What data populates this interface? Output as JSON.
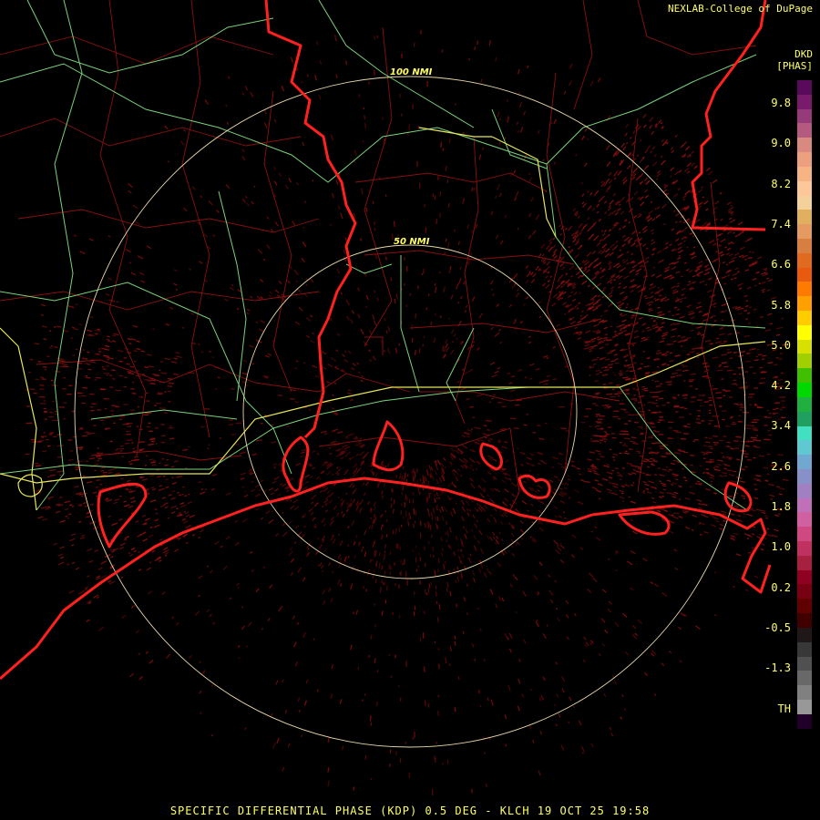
{
  "credit": "NEXLAB-College of DuPage",
  "legend": {
    "product": "DKD",
    "unit": "[PHAS]",
    "ticks": [
      "9.8",
      "9.0",
      "8.2",
      "7.4",
      "6.6",
      "5.8",
      "5.0",
      "4.2",
      "3.4",
      "2.6",
      "1.8",
      "1.0",
      "0.2",
      "-0.5",
      "-1.3",
      "TH"
    ],
    "colors": [
      "#5a0a5a",
      "#7a1a6a",
      "#963a7a",
      "#b45a80",
      "#d88a80",
      "#eca080",
      "#f6b484",
      "#fcc89a",
      "#f4d09a",
      "#e0b060",
      "#e49a60",
      "#d87e40",
      "#e06a20",
      "#e85a10",
      "#ff7a00",
      "#ffa000",
      "#ffcc00",
      "#ffff00",
      "#d8e000",
      "#a0d000",
      "#40c000",
      "#00d800",
      "#20b040",
      "#20a060",
      "#40e0c0",
      "#60c8d0",
      "#70a8d0",
      "#8890c8",
      "#a080c0",
      "#c070b8",
      "#d060a0",
      "#d04880",
      "#c03060",
      "#a82040",
      "#900020",
      "#780010",
      "#600000",
      "#400000",
      "#201818",
      "#383838",
      "#505050",
      "#686868",
      "#808080",
      "#989898",
      "#200028"
    ]
  },
  "rings": {
    "inner": "50 NMI",
    "outer": "100 NMI"
  },
  "footer": "SPECIFIC DIFFERENTIAL PHASE (KDP) 0.5 DEG - KLCH 19 OCT 25 19:58"
}
